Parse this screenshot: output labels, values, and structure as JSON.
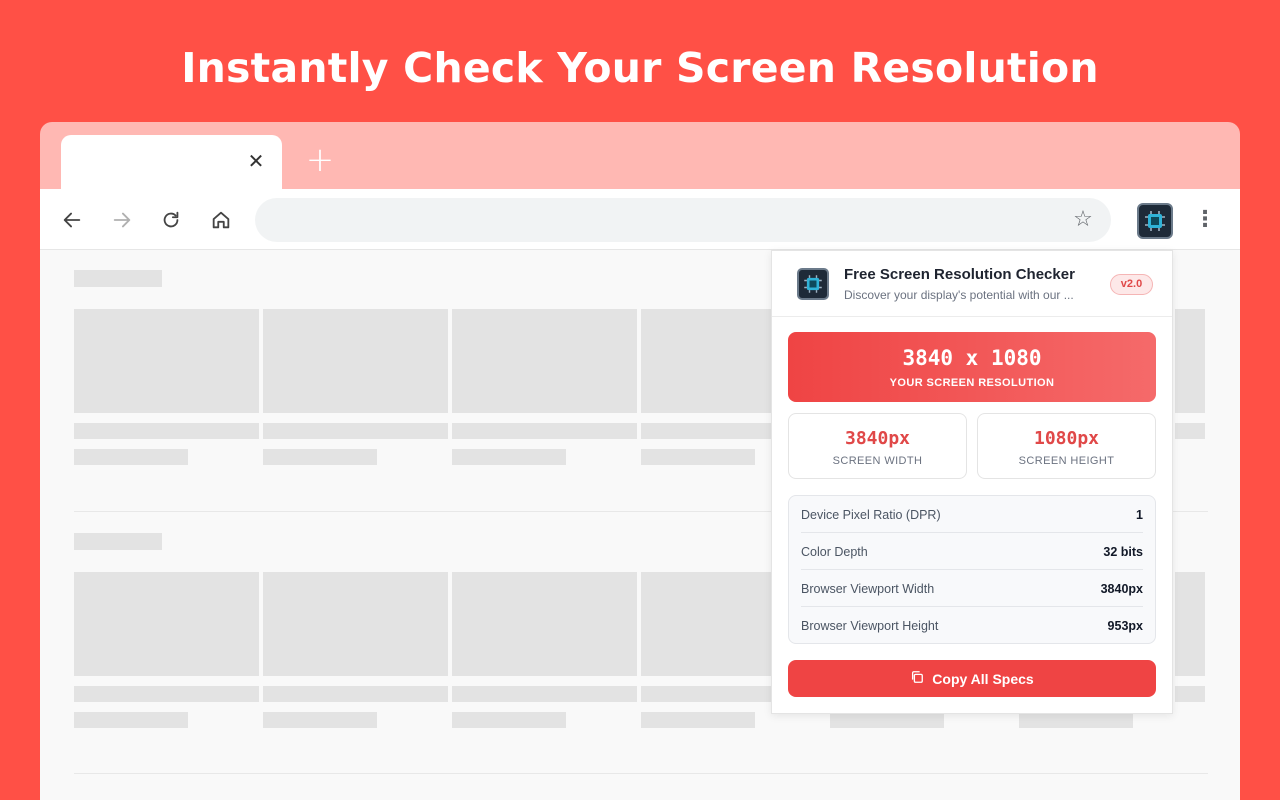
{
  "headline": "Instantly Check Your Screen Resolution",
  "browser": {
    "tab_close_glyph": "✕",
    "new_tab_glyph": "+",
    "star_glyph": "☆",
    "menu_glyph": "⋮",
    "icons": [
      "back-arrow-icon",
      "forward-arrow-icon",
      "reload-icon",
      "home-icon",
      "star-icon",
      "extension-icon",
      "menu-icon"
    ]
  },
  "popup": {
    "title": "Free Screen Resolution Checker",
    "subtitle": "Discover your display's potential with our ...",
    "version": "v2.0",
    "resolution": "3840 x 1080",
    "resolution_label": "YOUR SCREEN RESOLUTION",
    "width_value": "3840px",
    "width_label": "SCREEN WIDTH",
    "height_value": "1080px",
    "height_label": "SCREEN HEIGHT",
    "specs": [
      {
        "label": "Device Pixel Ratio (DPR)",
        "value": "1"
      },
      {
        "label": "Color Depth",
        "value": "32 bits"
      },
      {
        "label": "Browser Viewport Width",
        "value": "3840px"
      },
      {
        "label": "Browser Viewport Height",
        "value": "953px"
      }
    ],
    "copy_label": "Copy All Specs"
  },
  "colors": {
    "background": "#ff5046",
    "accent": "#ef4444",
    "accent_text": "#e04848"
  }
}
